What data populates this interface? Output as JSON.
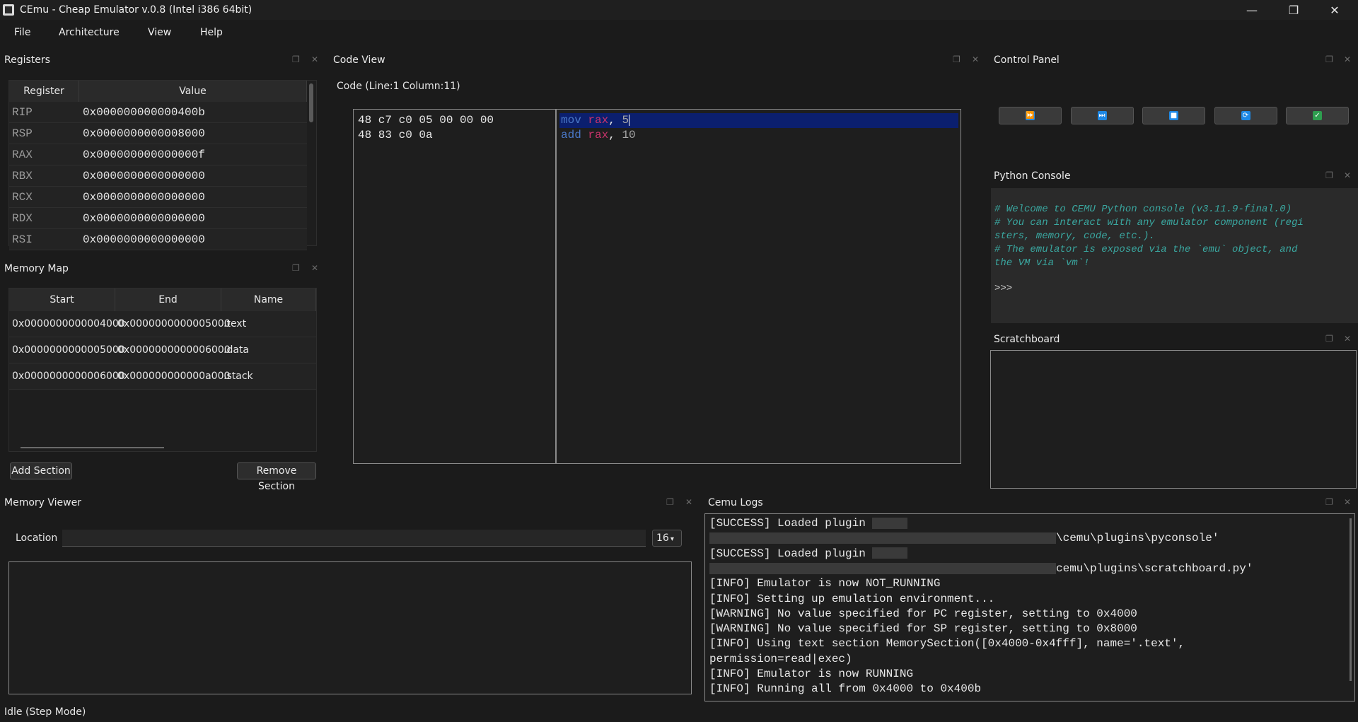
{
  "window": {
    "title": "CEmu - Cheap Emulator v.0.8 (Intel i386 64bit)",
    "minimize": "—",
    "restore": "❐",
    "close": "✕"
  },
  "menu": [
    "File",
    "Architecture",
    "View",
    "Help"
  ],
  "registers": {
    "title": "Registers",
    "headers": [
      "Register",
      "Value"
    ],
    "rows": [
      {
        "name": "RIP",
        "value": "0x000000000000400b"
      },
      {
        "name": "RSP",
        "value": "0x0000000000008000"
      },
      {
        "name": "RAX",
        "value": "0x000000000000000f"
      },
      {
        "name": "RBX",
        "value": "0x0000000000000000"
      },
      {
        "name": "RCX",
        "value": "0x0000000000000000"
      },
      {
        "name": "RDX",
        "value": "0x0000000000000000"
      },
      {
        "name": "RSI",
        "value": "0x0000000000000000"
      }
    ]
  },
  "memory_map": {
    "title": "Memory Map",
    "headers": [
      "Start",
      "End",
      "Name"
    ],
    "rows": [
      {
        "start": "0x0000000000004000",
        "end": "0x0000000000005000",
        "name": ".text"
      },
      {
        "start": "0x0000000000005000",
        "end": "0x0000000000006000",
        "name": ".data"
      },
      {
        "start": "0x0000000000006000",
        "end": "0x000000000000a000",
        "name": ".stack"
      }
    ],
    "add_label": "Add Section",
    "remove_label": "Remove Section"
  },
  "code_view": {
    "title": "Code View",
    "position": "Code (Line:1 Column:11)",
    "bytes": [
      "48 c7 c0 05 00 00 00",
      "48 83 c0 0a"
    ],
    "lines": [
      {
        "mnemonic": "mov",
        "reg": "rax",
        "sep": ", ",
        "imm": "5"
      },
      {
        "mnemonic": "add",
        "reg": "rax",
        "sep": ", ",
        "imm": "10"
      }
    ]
  },
  "control_panel": {
    "title": "Control Panel",
    "buttons": [
      {
        "icon": "run-icon",
        "glyph": "⏩",
        "color": "#1e88e5"
      },
      {
        "icon": "step-icon",
        "glyph": "⏭",
        "color": "#1e88e5"
      },
      {
        "icon": "stop-icon",
        "glyph": "■",
        "color": "#1e88e5"
      },
      {
        "icon": "reset-icon",
        "glyph": "⟳",
        "color": "#1e88e5"
      },
      {
        "icon": "check-icon",
        "glyph": "✓",
        "color": "#2e9e4f"
      }
    ]
  },
  "python_console": {
    "title": "Python Console",
    "lines": [
      "# Welcome to CEMU Python console (v3.11.9-final.0)",
      "# You can interact with any emulator component (regi",
      "sters, memory, code, etc.).",
      "# The emulator is exposed via the `emu` object, and",
      "the VM via `vm`!"
    ],
    "prompt": ">>>"
  },
  "scratchboard": {
    "title": "Scratchboard"
  },
  "memory_viewer": {
    "title": "Memory Viewer",
    "location_label": "Location",
    "size_value": "16"
  },
  "logs": {
    "title": "Cemu Logs",
    "lines": [
      {
        "pre": "[SUCCESS] Loaded plugin ",
        "redact1": true,
        "post": ""
      },
      {
        "pre": "",
        "redact2": true,
        "post": "\\cemu\\plugins\\pyconsole'"
      },
      {
        "pre": "[SUCCESS] Loaded plugin ",
        "redact1": true,
        "post": ""
      },
      {
        "pre": "",
        "redact2": true,
        "post": "cemu\\plugins\\scratchboard.py'"
      },
      {
        "pre": "[INFO] Emulator is now NOT_RUNNING"
      },
      {
        "pre": "[INFO] Setting up emulation environment..."
      },
      {
        "pre": "[WARNING] No value specified for PC register, setting to 0x4000"
      },
      {
        "pre": "[WARNING] No value specified for SP register, setting to 0x8000"
      },
      {
        "pre": "[INFO] Using text section MemorySection([0x4000-0x4fff], name='.text',"
      },
      {
        "pre": "permission=read|exec)"
      },
      {
        "pre": "[INFO] Emulator is now RUNNING"
      },
      {
        "pre": "[INFO] Running all from 0x4000 to 0x400b"
      }
    ]
  },
  "status": "Idle (Step Mode)"
}
